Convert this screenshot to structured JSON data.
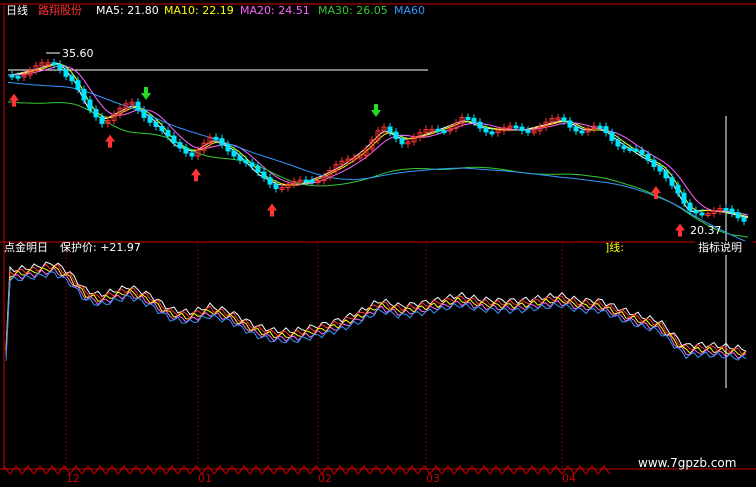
{
  "header": {
    "period": "日线",
    "stock_name": "路翔股份",
    "ma_labels": [
      {
        "text": "MA5: 21.80",
        "color": "#ffffff"
      },
      {
        "text": "MA10: 22.19",
        "color": "#ffff00"
      },
      {
        "text": "MA20: 24.51",
        "color": "#ff66ff"
      },
      {
        "text": "MA30: 26.05",
        "color": "#33cc33"
      },
      {
        "text": "MA60",
        "color": "#3399ff"
      }
    ]
  },
  "indicator": {
    "title": "点金明日",
    "protect_label": "保护价: +21.97",
    "right_label_partial": "]线:",
    "help_button": "指标说明"
  },
  "axis_months": [
    "12",
    "01",
    "02",
    "03",
    "04"
  ],
  "watermark": "www.7gpzb.com",
  "colors": {
    "up": "#ff3333",
    "down": "#00e5ff",
    "ma5": "#ffffff",
    "ma10": "#ffff00",
    "ma20": "#ff66ff",
    "ma30": "#33cc33",
    "ma60": "#3399ff",
    "buy_arrow": "#ff3333",
    "sell_arrow": "#22dd22"
  },
  "chart_data": {
    "type": "candlestick",
    "annotations": [
      {
        "text": "35.60",
        "kind": "high-marker"
      },
      {
        "text": "20.37",
        "kind": "low-marker"
      }
    ],
    "ma_last": {
      "MA5": 21.8,
      "MA10": 22.19,
      "MA20": 24.51,
      "MA30": 26.05
    },
    "buy_signals": 7,
    "sell_signals": 2
  }
}
